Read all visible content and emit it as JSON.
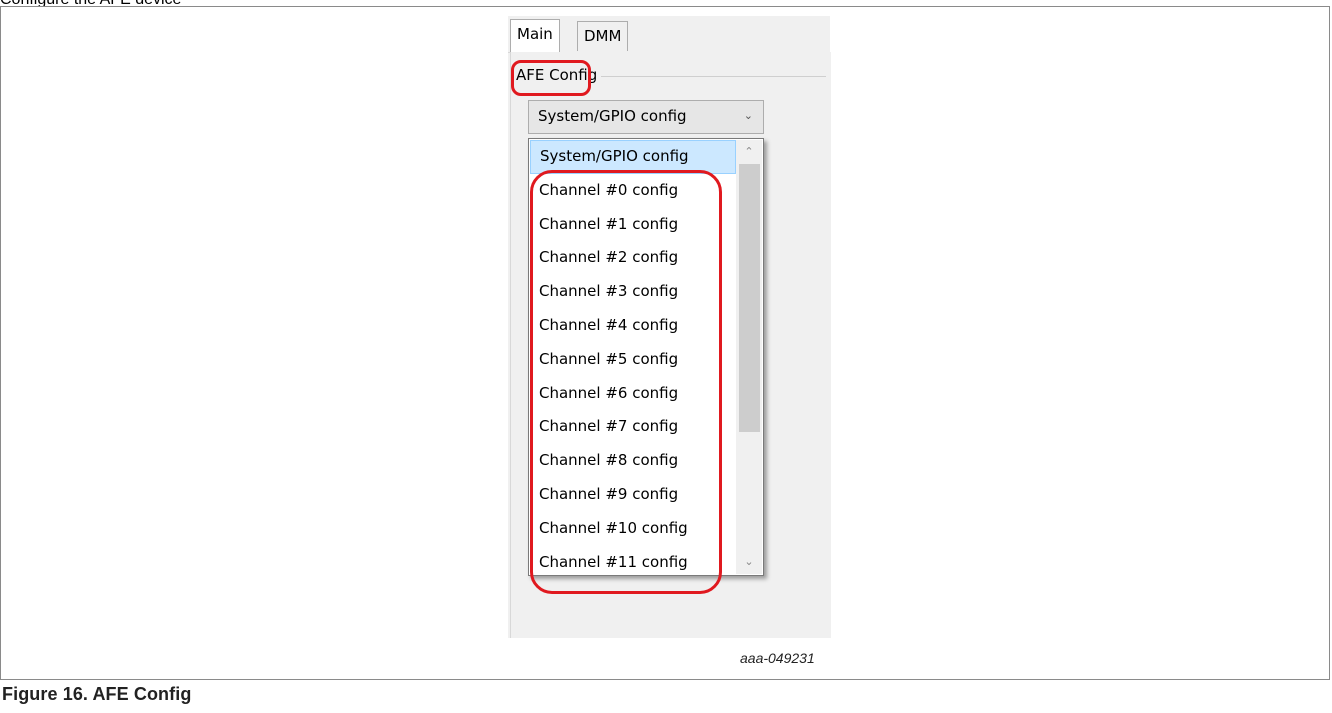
{
  "page": {
    "top_fragment": "Configure the AFE device"
  },
  "app": {
    "tabs": [
      {
        "label": "Main",
        "active": true
      },
      {
        "label": "DMM",
        "active": false
      }
    ],
    "group_label": "AFE Config",
    "combo": {
      "selected_value": "System/GPIO config",
      "arrow_icon": "chevron-down-icon"
    },
    "dropdown": {
      "options": [
        "System/GPIO config",
        "Channel #0 config",
        "Channel #1 config",
        "Channel #2 config",
        "Channel #3 config",
        "Channel #4 config",
        "Channel #5 config",
        "Channel #6 config",
        "Channel #7 config",
        "Channel #8 config",
        "Channel #9 config",
        "Channel #10 config",
        "Channel #11 config"
      ],
      "highlighted_index": 0,
      "scroll_up_icon": "chevron-up-icon",
      "scroll_down_icon": "chevron-down-icon"
    }
  },
  "figure": {
    "id": "aaa-049231",
    "caption": "Figure 16.  AFE Config"
  },
  "colors": {
    "highlight_outline": "#e0191f",
    "selection_bg": "#cce8ff"
  }
}
